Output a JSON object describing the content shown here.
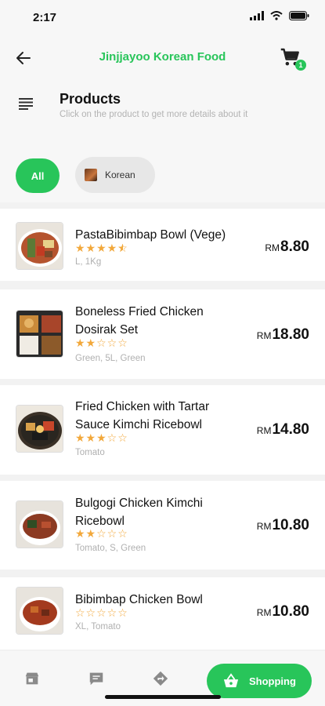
{
  "status": {
    "time": "2:17"
  },
  "header": {
    "title": "Jinjjayoo Korean Food",
    "cart_count": "1"
  },
  "products_header": {
    "title": "Products",
    "subtitle": "Click on the product to get more details about it"
  },
  "filters": [
    {
      "label": "All",
      "active": true
    },
    {
      "label": "Korean",
      "active": false
    }
  ],
  "products": [
    {
      "name_lines": [
        "PastaBibimbap Bowl (Vege)"
      ],
      "rating": 4.5,
      "meta": "L, 1Kg",
      "currency": "RM",
      "price": "8.80"
    },
    {
      "name_lines": [
        "Boneless Fried Chicken",
        "Dosirak Set"
      ],
      "rating": 2,
      "meta": "Green, 5L, Green",
      "currency": "RM",
      "price": "18.80"
    },
    {
      "name_lines": [
        "Fried Chicken with Tartar",
        "Sauce Kimchi Ricebowl"
      ],
      "rating": 3,
      "meta": "Tomato",
      "currency": "RM",
      "price": "14.80"
    },
    {
      "name_lines": [
        "Bulgogi Chicken Kimchi",
        "Ricebowl"
      ],
      "rating": 2,
      "meta": "Tomato, S, Green",
      "currency": "RM",
      "price": "10.80"
    },
    {
      "name_lines": [
        "Bibimbap Chicken Bowl"
      ],
      "rating": 0,
      "meta": "XL, Tomato",
      "currency": "RM",
      "price": "10.80"
    }
  ],
  "bottom_nav": {
    "items": [
      "store-icon",
      "chat-icon",
      "directions-icon"
    ],
    "shopping_label": "Shopping"
  },
  "colors": {
    "accent": "#28c55a",
    "star": "#f2a83b"
  }
}
